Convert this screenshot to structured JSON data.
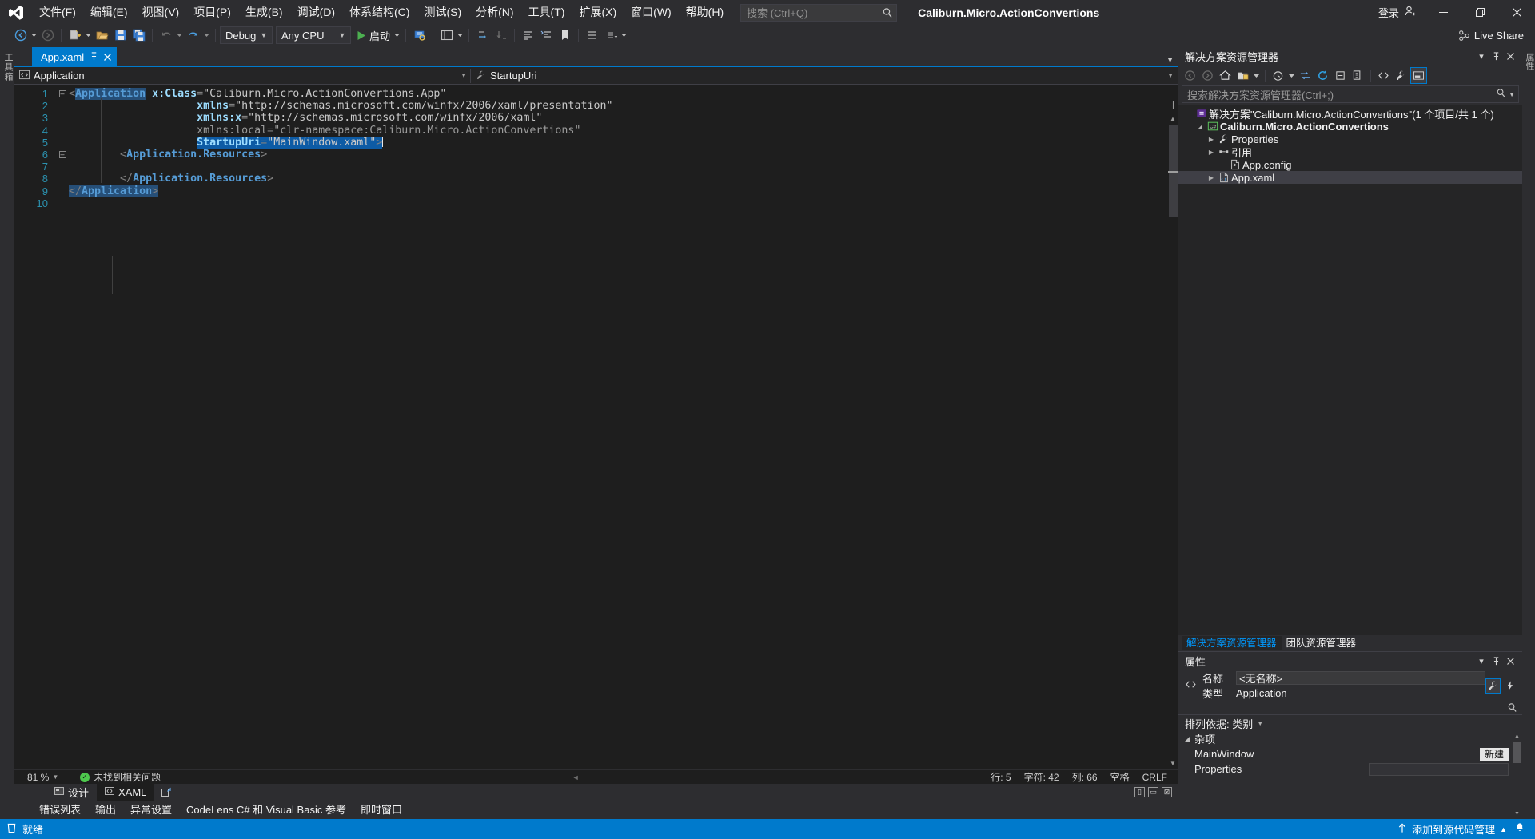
{
  "titlebar": {
    "menu": [
      "文件(F)",
      "编辑(E)",
      "视图(V)",
      "项目(P)",
      "生成(B)",
      "调试(D)",
      "体系结构(C)",
      "测试(S)",
      "分析(N)",
      "工具(T)",
      "扩展(X)",
      "窗口(W)",
      "帮助(H)"
    ],
    "search_placeholder": "搜索 (Ctrl+Q)",
    "window_title": "Caliburn.Micro.ActionConvertions",
    "signin_label": "登录",
    "minimize": "—",
    "maximize": "❐",
    "close": "✕"
  },
  "toolbar": {
    "config": "Debug",
    "platform": "Any CPU",
    "start_label": "启动",
    "live_share": "Live Share"
  },
  "left_rail": {
    "label": "工具箱"
  },
  "editor": {
    "tab_label": "App.xaml",
    "tab_pin": "ᛩ",
    "tab_close": "✕",
    "nav_left": "Application",
    "nav_right": "StartupUri",
    "lines": [
      {
        "n": "1",
        "glyph": "minus",
        "segments": [
          {
            "t": "<",
            "c": "tk-brk"
          },
          {
            "t": "Application",
            "c": "tk-el sel"
          },
          {
            "t": " ",
            "c": "tk-dim"
          },
          {
            "t": "x:Class",
            "c": "tk-attr"
          },
          {
            "t": "=",
            "c": "tk-eq"
          },
          {
            "t": "\"Caliburn.Micro.ActionConvertions.App\"",
            "c": "tk-str"
          }
        ]
      },
      {
        "n": "2",
        "glyph": "",
        "indent": 5,
        "segments": [
          {
            "t": "xmlns",
            "c": "tk-attr"
          },
          {
            "t": "=",
            "c": "tk-eq"
          },
          {
            "t": "\"http://schemas.microsoft.com/winfx/2006/xaml/presentation\"",
            "c": "tk-str"
          }
        ]
      },
      {
        "n": "3",
        "glyph": "",
        "indent": 5,
        "segments": [
          {
            "t": "xmlns:x",
            "c": "tk-attr"
          },
          {
            "t": "=",
            "c": "tk-eq"
          },
          {
            "t": "\"http://schemas.microsoft.com/winfx/2006/xaml\"",
            "c": "tk-str"
          }
        ]
      },
      {
        "n": "4",
        "glyph": "",
        "indent": 5,
        "segments": [
          {
            "t": "xmlns:local",
            "c": "tk-dim"
          },
          {
            "t": "=",
            "c": "tk-eq"
          },
          {
            "t": "\"clr-namespace:Caliburn.Micro.ActionConvertions\"",
            "c": "tk-dim"
          }
        ]
      },
      {
        "n": "5",
        "glyph": "",
        "indent": 5,
        "segments": [
          {
            "t": "StartupUri",
            "c": "tk-attr selb"
          },
          {
            "t": "=",
            "c": "tk-eq selb"
          },
          {
            "t": "\"MainWindow.xaml\"",
            "c": "tk-str selb"
          },
          {
            "t": ">",
            "c": "tk-brk selb"
          }
        ]
      },
      {
        "n": "6",
        "glyph": "minus",
        "indent": 2,
        "segments": [
          {
            "t": "<",
            "c": "tk-brk"
          },
          {
            "t": "Application.Resources",
            "c": "tk-el"
          },
          {
            "t": ">",
            "c": "tk-brk"
          }
        ]
      },
      {
        "n": "7",
        "glyph": "",
        "segments": []
      },
      {
        "n": "8",
        "glyph": "",
        "indent": 2,
        "segments": [
          {
            "t": "</",
            "c": "tk-brk"
          },
          {
            "t": "Application.Resources",
            "c": "tk-el"
          },
          {
            "t": ">",
            "c": "tk-brk"
          }
        ]
      },
      {
        "n": "9",
        "glyph": "",
        "indent": 0,
        "segments": [
          {
            "t": "</",
            "c": "tk-brk sel"
          },
          {
            "t": "Application",
            "c": "tk-el sel"
          },
          {
            "t": ">",
            "c": "tk-brk sel"
          }
        ]
      },
      {
        "n": "10",
        "glyph": "",
        "segments": []
      }
    ],
    "zoom": "81 %",
    "issues": "未找到相关问题",
    "pos_line": "行: 5",
    "pos_char": "字符: 42",
    "pos_col": "列: 66",
    "pos_space": "空格",
    "pos_eol": "CRLF",
    "designer_tabs": [
      {
        "label": "设计",
        "icon": "design-icon",
        "active": false
      },
      {
        "label": "XAML",
        "icon": "xaml-icon",
        "active": true
      }
    ]
  },
  "dock_tabs": [
    "错误列表",
    "输出",
    "异常设置",
    "CodeLens C# 和 Visual Basic 参考",
    "即时窗口"
  ],
  "solution_explorer": {
    "title": "解决方案资源管理器",
    "search_placeholder": "搜索解决方案资源管理器(Ctrl+;)",
    "tree": [
      {
        "indent": 0,
        "expander": "",
        "icon": "solution-icon",
        "label": "解决方案\"Caliburn.Micro.ActionConvertions\"(1 个项目/共 1 个)",
        "bold": false,
        "selected": false
      },
      {
        "indent": 1,
        "expander": "▼",
        "icon": "csharp-project-icon",
        "label": "Caliburn.Micro.ActionConvertions",
        "bold": true,
        "selected": false
      },
      {
        "indent": 2,
        "expander": "▶",
        "icon": "properties-icon",
        "label": "Properties",
        "bold": false,
        "selected": false
      },
      {
        "indent": 2,
        "expander": "▶",
        "icon": "references-icon",
        "label": "引用",
        "bold": false,
        "selected": false
      },
      {
        "indent": 3,
        "expander": "",
        "icon": "config-file-icon",
        "label": "App.config",
        "bold": false,
        "selected": false
      },
      {
        "indent": 2,
        "expander": "▶",
        "icon": "xaml-file-icon",
        "label": "App.xaml",
        "bold": false,
        "selected": true
      }
    ],
    "tabs": [
      {
        "label": "解决方案资源管理器",
        "active": true
      },
      {
        "label": "团队资源管理器",
        "active": false
      }
    ]
  },
  "properties": {
    "title": "属性",
    "name_key": "名称",
    "name_value": "<无名称>",
    "type_key": "类型",
    "type_value": "Application",
    "sort_label": "排列依据: 类别",
    "category": "杂项",
    "rows": [
      {
        "key": "MainWindow",
        "value_kind": "button",
        "value": "新建"
      },
      {
        "key": "Properties",
        "value_kind": "field",
        "value": ""
      }
    ]
  },
  "right_rail": {
    "label": "属性"
  },
  "statusbar": {
    "ready": "就绪",
    "source_control": "添加到源代码管理",
    "caret_up": "▲",
    "bell": "🔔"
  }
}
